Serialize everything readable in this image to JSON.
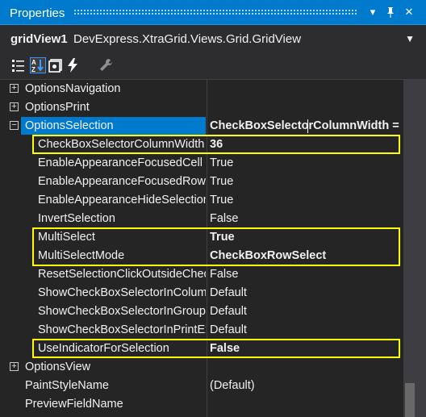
{
  "window": {
    "title": "Properties"
  },
  "object_selector": {
    "name": "gridView1",
    "type": "DevExpress.XtraGrid.Views.Grid.GridView"
  },
  "toolbar": {
    "icons": [
      "categorized-icon",
      "alphabetical-icon",
      "properties-icon",
      "events-icon",
      "property-pages-icon"
    ]
  },
  "colors": {
    "accent": "#007acc",
    "highlight": "#ffff00",
    "background": "#252526"
  },
  "properties": [
    {
      "name": "OptionsNavigation",
      "value": "",
      "expandable": true,
      "expanded": false
    },
    {
      "name": "OptionsPrint",
      "value": "",
      "expandable": true,
      "expanded": false
    },
    {
      "name": "OptionsSelection",
      "value": "CheckBoxSelectorColumnWidth =",
      "expandable": true,
      "expanded": true,
      "selected": true
    },
    {
      "name": "CheckBoxSelectorColumnWidth",
      "value": "36",
      "bold": true
    },
    {
      "name": "EnableAppearanceFocusedCell",
      "value": "True"
    },
    {
      "name": "EnableAppearanceFocusedRow",
      "value": "True"
    },
    {
      "name": "EnableAppearanceHideSelection",
      "value": "True"
    },
    {
      "name": "InvertSelection",
      "value": "False"
    },
    {
      "name": "MultiSelect",
      "value": "True",
      "bold": true
    },
    {
      "name": "MultiSelectMode",
      "value": "CheckBoxRowSelect",
      "bold": true
    },
    {
      "name": "ResetSelectionClickOutsideCheckboxSelector",
      "value": "False"
    },
    {
      "name": "ShowCheckBoxSelectorInColumnHeader",
      "value": "Default"
    },
    {
      "name": "ShowCheckBoxSelectorInGroupRow",
      "value": "Default"
    },
    {
      "name": "ShowCheckBoxSelectorInPrintExport",
      "value": "Default"
    },
    {
      "name": "UseIndicatorForSelection",
      "value": "False",
      "bold": true
    },
    {
      "name": "OptionsView",
      "value": "",
      "expandable": true,
      "expanded": false
    },
    {
      "name": "PaintStyleName",
      "value": "(Default)"
    },
    {
      "name": "PreviewFieldName",
      "value": ""
    }
  ]
}
